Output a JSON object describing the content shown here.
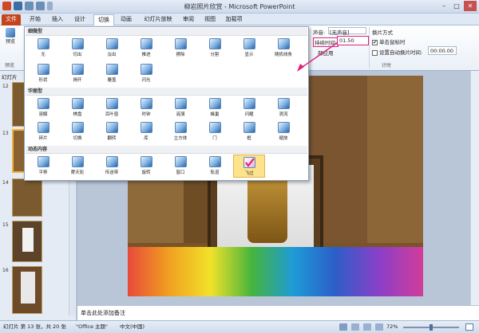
{
  "window": {
    "title": "柳岩照片欣赏 - Microsoft PowerPoint",
    "minimize": "–",
    "maximize": "□",
    "close": "✕"
  },
  "tabs": [
    "文件",
    "开始",
    "插入",
    "设计",
    "切换",
    "动画",
    "幻灯片放映",
    "审阅",
    "视图",
    "加载项"
  ],
  "ribbon": {
    "preview_label": "预览",
    "preview_group": "预览",
    "sound_label": "声音:",
    "sound_value": "[无声音]",
    "duration_label": "持续时间:",
    "duration_value": "01.50",
    "apply_all": "部应用",
    "advance_title": "换片方式",
    "on_click": "单击鼠标时",
    "on_click_mark": "✔",
    "auto_after": "设置自动换片时间:",
    "auto_value": "00:00.00",
    "timing_group": "计时"
  },
  "gallery": {
    "sections": [
      {
        "title": "细微型",
        "items": [
          "无",
          "切出",
          "淡出",
          "推进",
          "擦除",
          "分割",
          "显示",
          "随机线条",
          "形状",
          "揭开",
          "覆盖",
          "闪光"
        ]
      },
      {
        "title": "华丽型",
        "items": [
          "溶解",
          "棋盘",
          "百叶窗",
          "时钟",
          "涟漪",
          "蜂巢",
          "闪耀",
          "涡流",
          "碎片",
          "切换",
          "翻转",
          "库",
          "立方体",
          "门",
          "框",
          "缩放"
        ]
      },
      {
        "title": "动态内容",
        "items": [
          "平移",
          "摩天轮",
          "传送带",
          "旋转",
          "窗口",
          "轨道",
          "飞过"
        ]
      }
    ],
    "selected": "飞过"
  },
  "slides_panel": {
    "header": "幻灯片",
    "numbers": [
      "12",
      "13",
      "14",
      "15",
      "16"
    ]
  },
  "notes_placeholder": "单击此处添加备注",
  "status": {
    "slide_info": "幻灯片 第 13 张，共 20 张",
    "theme": "\"Office 主题\"",
    "language": "中文(中国)",
    "zoom": "72%"
  },
  "colors": {
    "file_tab": "#c4441c",
    "selected_tile": "#fde38d",
    "annotation": "#e0207f"
  }
}
